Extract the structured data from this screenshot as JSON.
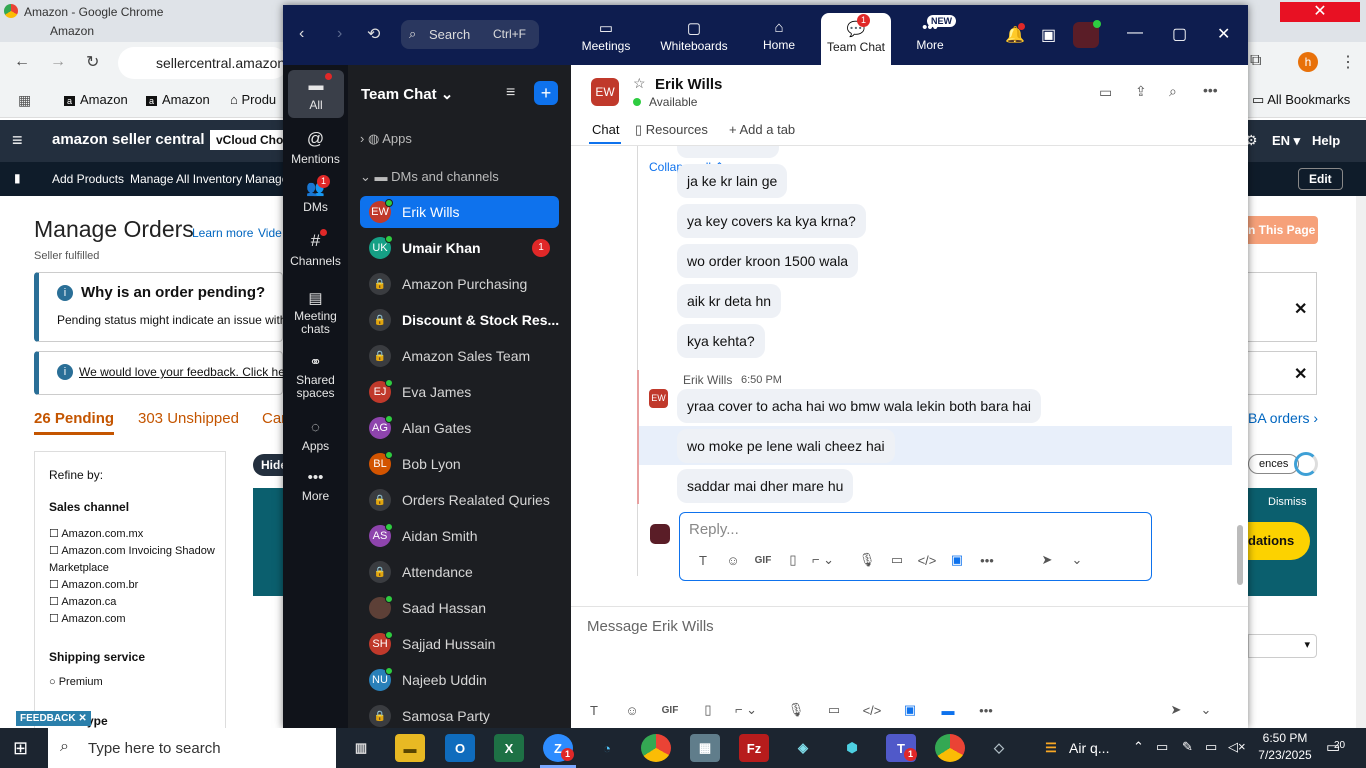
{
  "chrome": {
    "window_title": "Amazon - Google Chrome",
    "tab1": "Amazon",
    "url": "sellercentral.amazon",
    "bookmarks": [
      "Amazon",
      "Amazon",
      "Produ"
    ],
    "all_bookmarks": "All Bookmarks",
    "profile_initial": "h"
  },
  "amazon": {
    "logo": "amazon seller central",
    "vcloud": "vCloud Choic",
    "lang": "EN",
    "help": "Help",
    "nav": [
      "Add Products",
      "Manage All Inventory",
      "Manage"
    ],
    "edit": "Edit",
    "page_title": "Manage Orders",
    "learn_more": "Learn more",
    "video": "Vide",
    "seller_fulfilled": "Seller fulfilled",
    "pending_title": "Why is an order pending?",
    "pending_text": "Pending status might indicate an issue with t",
    "feedback_link": "We would love your feedback. Click here",
    "tab_pending": "26 Pending",
    "tab_unshipped": "303 Unshipped",
    "tab_can": "Can",
    "refine": "Refine by:",
    "sales_channel": "Sales channel",
    "channels": [
      "Amazon.com.mx",
      "Amazon.com Invoicing Shadow Marketplace",
      "Amazon.com.br",
      "Amazon.ca",
      "Amazon.com"
    ],
    "shipping_service": "Shipping service",
    "premium": "Premium",
    "type_partial": "ype",
    "feedback_tab": "FEEDBACK",
    "hide": "Hide",
    "this_page": "n This Page",
    "fba_orders": "BA orders",
    "ences": "ences",
    "dismiss": "Dismiss",
    "dations": "dations"
  },
  "zoom": {
    "search": "Search",
    "search_shortcut": "Ctrl+F",
    "top_tabs": [
      {
        "label": "Meetings"
      },
      {
        "label": "Whiteboards"
      },
      {
        "label": "Home"
      },
      {
        "label": "Team Chat",
        "badge": "1"
      },
      {
        "label": "More",
        "badge": "NEW"
      }
    ],
    "rail": [
      {
        "label": "All"
      },
      {
        "label": "Mentions"
      },
      {
        "label": "DMs",
        "badge": "1"
      },
      {
        "label": "Channels"
      },
      {
        "label": "Meeting chats"
      },
      {
        "label": "Shared spaces"
      },
      {
        "label": "Apps"
      },
      {
        "label": "More"
      }
    ],
    "list_title": "Team Chat",
    "apps": "Apps",
    "dms_channels": "DMs and channels",
    "items": [
      {
        "name": "Erik Wills",
        "initials": "EW",
        "color": "#c0392b",
        "online": true,
        "active": true
      },
      {
        "name": "Umair Khan",
        "initials": "UK",
        "color": "#16a085",
        "online": true,
        "bold": true,
        "badge": "1"
      },
      {
        "name": "Amazon Purchasing",
        "lock": true
      },
      {
        "name": "Discount & Stock Res...",
        "lock": true,
        "bold": true
      },
      {
        "name": "Amazon Sales Team",
        "lock": true
      },
      {
        "name": "Eva James",
        "initials": "EJ",
        "color": "#c0392b",
        "online": true
      },
      {
        "name": "Alan Gates",
        "initials": "AG",
        "color": "#8e44ad",
        "online": true
      },
      {
        "name": "Bob Lyon",
        "initials": "BL",
        "color": "#d35400",
        "online": true
      },
      {
        "name": "Orders Realated Quries",
        "lock": true
      },
      {
        "name": "Aidan Smith",
        "initials": "AS",
        "color": "#8e44ad",
        "online": true
      },
      {
        "name": "Attendance",
        "lock": true
      },
      {
        "name": "Saad Hassan",
        "initials": "",
        "color": "#5d4037",
        "online": true
      },
      {
        "name": "Sajjad Hussain",
        "initials": "SH",
        "color": "#c0392b",
        "online": true
      },
      {
        "name": "Najeeb Uddin",
        "initials": "NU",
        "color": "#2980b9",
        "online": true
      },
      {
        "name": "Samosa Party",
        "lock": true
      }
    ],
    "contact": {
      "initials": "EW",
      "name": "Erik Wills",
      "status": "Available"
    },
    "chat_tabs": {
      "chat": "Chat",
      "resources": "Resources",
      "add": "Add a tab"
    },
    "collapse_all": "Collapse all",
    "messages_prev": [
      "ja ke kr lain ge",
      "ya key covers ka kya krna?",
      "wo order kroon 1500 wala",
      "aik kr deta hn",
      "kya kehta?"
    ],
    "sender": "Erik Wills",
    "sender_time": "6:50 PM",
    "messages": [
      "yraa cover to acha hai wo bmw wala lekin both bara hai",
      "wo moke pe lene wali cheez hai",
      "saddar mai dher mare hu"
    ],
    "reply_placeholder": "Reply...",
    "message_placeholder": "Message Erik Wills"
  },
  "taskbar": {
    "search": "Type here to search",
    "time": "6:50 PM",
    "date": "7/23/2025",
    "air": "Air q...",
    "notif_count": "20",
    "zoom_badge": "1",
    "teams_badge": "1"
  }
}
